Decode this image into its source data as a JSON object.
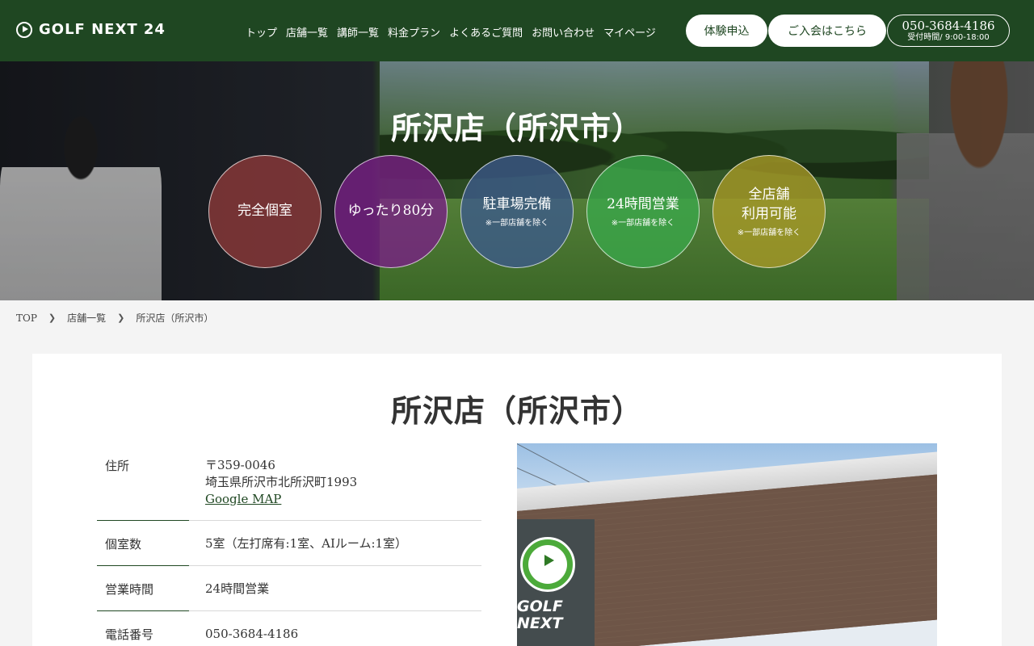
{
  "header": {
    "logo_text": "GOLF NEXT 24",
    "nav": [
      "トップ",
      "店舗一覧",
      "講師一覧",
      "料金プラン",
      "よくあるご質問",
      "お問い合わせ",
      "マイページ"
    ],
    "trial_button": "体験申込",
    "join_button": "ご入会はこちら",
    "phone": "050-3684-4186",
    "hours": "受付時間/ 9:00-18:00"
  },
  "hero": {
    "title": "所沢店（所沢市）",
    "features": [
      {
        "main": "完全個室",
        "note": "",
        "color": "#8e3a3a"
      },
      {
        "main": "ゆったり80分",
        "note": "",
        "color": "#7a1f86"
      },
      {
        "main": "駐車場完備",
        "note": "※一部店舗を除く",
        "color": "#3c5a8c"
      },
      {
        "main": "24時間営業",
        "note": "※一部店舗を除く",
        "color": "#3aa84a"
      },
      {
        "main": "全店舗\n利用可能",
        "note": "※一部店舗を除く",
        "color": "#a99a26"
      }
    ]
  },
  "breadcrumb": [
    "TOP",
    "店舗一覧",
    "所沢店（所沢市）"
  ],
  "store": {
    "title": "所沢店（所沢市）",
    "address_label": "住所",
    "postal": "〒359-0046",
    "address": "埼玉県所沢市北所沢町1993",
    "map_link": "Google MAP",
    "rooms_label": "個室数",
    "rooms": "5室（左打席有:1室、AIルーム:1室）",
    "hours_label": "営業時間",
    "hours": "24時間営業",
    "phone_label": "電話番号",
    "phone": "050-3684-4186"
  },
  "colors": {
    "brand_green": "#1f4722"
  },
  "icons": {
    "logo": "golf-flag-icon",
    "breadcrumb_sep": "chevron-right-icon"
  }
}
